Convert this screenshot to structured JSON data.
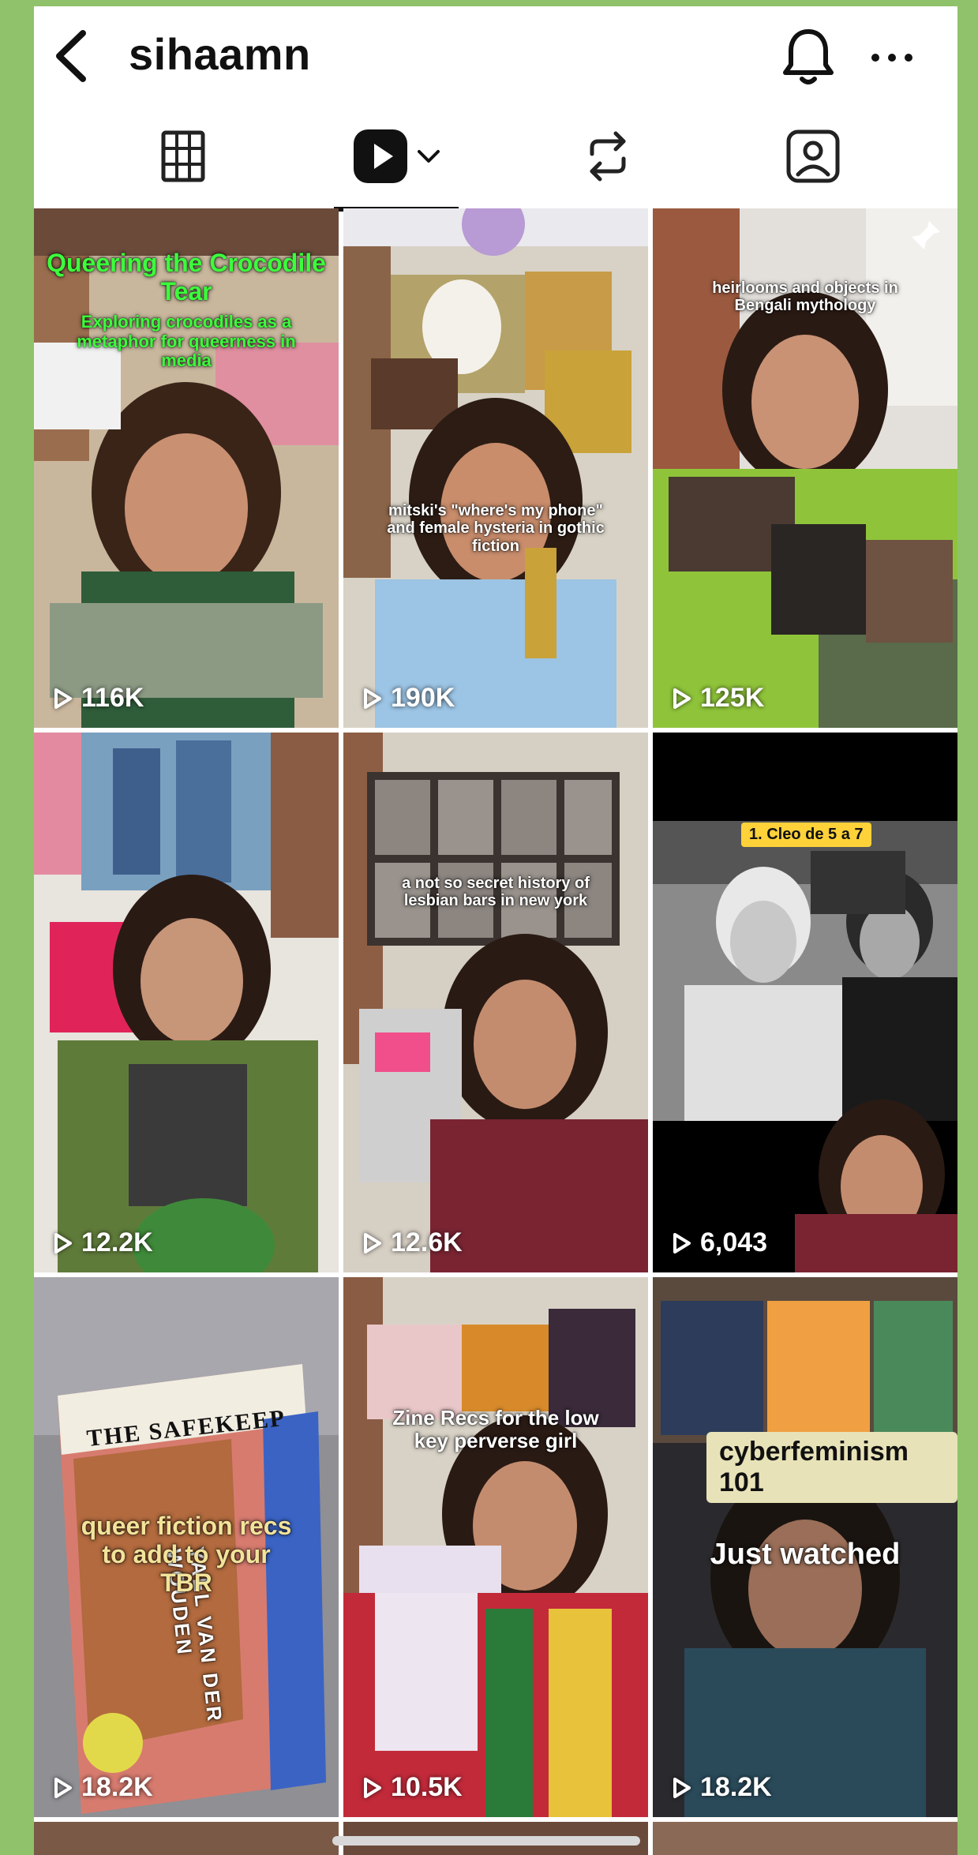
{
  "header": {
    "username": "sihaamn",
    "icons": {
      "back": "chevron-left-icon",
      "notifications": "bell-icon",
      "more": "more-horizontal-icon"
    }
  },
  "tabs": [
    {
      "name": "grid",
      "icon": "grid-icon",
      "selected": false
    },
    {
      "name": "videos",
      "icon": "play-icon",
      "selected": true
    },
    {
      "name": "reposts",
      "icon": "repost-icon",
      "selected": false
    },
    {
      "name": "tagged",
      "icon": "tagged-person-icon",
      "selected": false
    }
  ],
  "colors": {
    "background": "#8fc26a",
    "title_green": "#3cff3c",
    "highlight_yellow": "#ffd23a",
    "fiction_text": "#f2e39a"
  },
  "videos": [
    {
      "views": "116K",
      "title": "Queering the Crocodile Tear",
      "subtitle": "Exploring crocodiles as a metaphor for queerness in media",
      "pinned": true
    },
    {
      "views": "190K",
      "caption": "mitski's \"where's my phone\" and female hysteria in gothic fiction",
      "pinned": true
    },
    {
      "views": "125K",
      "caption": "heirlooms and objects in Bengali mythology",
      "pinned": true
    },
    {
      "views": "12.2K"
    },
    {
      "views": "12.6K",
      "caption": "a not so secret history of lesbian bars in new york"
    },
    {
      "views": "6,043",
      "badge": "1. Cleo de 5 a 7"
    },
    {
      "views": "18.2K",
      "book_title": "THE SAFEKEEP",
      "book_author": "YAEL VAN DER WOUDEN",
      "caption": "queer fiction recs to add to your TBR"
    },
    {
      "views": "10.5K",
      "caption": "Zine Recs for the low key perverse girl"
    },
    {
      "views": "18.2K",
      "pill": "cyberfeminism 101",
      "caption": "Just watched"
    }
  ]
}
